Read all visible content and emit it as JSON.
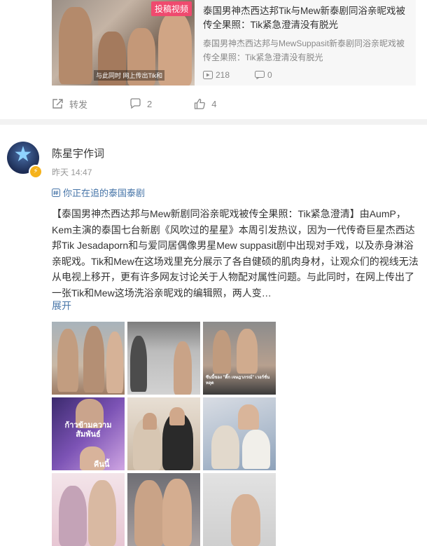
{
  "repost": {
    "tag": "投稿视频",
    "thumb_caption": "与此同时 网上传出Tik和",
    "title": "泰国男神杰西达邦Tik与Mew新泰剧同浴亲昵戏被传全果照：Tik紧急澄清没有脱光",
    "subtitle": "泰国男神杰西达邦与MewSuppasit新泰剧同浴亲昵戏被传全果照：Tik紧急澄清没有脱光",
    "views": "218",
    "comments": "0"
  },
  "actions": {
    "repost_label": "转发",
    "comment_count": "2",
    "like_count": "4"
  },
  "post": {
    "username": "陈星宇作词",
    "timestamp": "昨天 14:47",
    "topic": "你正在追的泰国泰剧",
    "text": "【泰国男神杰西达邦与Mew新剧同浴亲昵戏被传全果照：Tik紧急澄清】由AumP，Kem主演的泰国七台新剧《风吹过的星星》本周引发热议，因为一代传奇巨星杰西达邦Tik Jesadaporn和与爱同居偶像男星Mew suppasit剧中出现对手戏，以及赤身淋浴亲昵戏。Tik和Mew在这场戏里充分展示了各自健硕的肌肉身材，让观众们的视线无法从电视上移开，更有许多网友讨论关于人物配对属性问题。与此同时，在网上传出了一张Tik和Mew这场洗浴亲昵戏的编辑照，两人变…",
    "expand_label": "展开"
  },
  "photos": [
    {
      "name": "photo-1",
      "overlay": ""
    },
    {
      "name": "photo-2",
      "overlay": ""
    },
    {
      "name": "photo-3",
      "overlay": "ซีนนี้ของ \"ติ๊ก เจษฎาภรณ์\" เวอร์ชั่นหลุด"
    },
    {
      "name": "photo-4",
      "overlay": "ก้าวข้ามความสัมพันธ์"
    },
    {
      "name": "photo-5",
      "overlay": ""
    },
    {
      "name": "photo-6",
      "overlay": ""
    },
    {
      "name": "photo-7",
      "overlay": ""
    },
    {
      "name": "photo-8",
      "overlay": ""
    },
    {
      "name": "photo-9",
      "overlay": ""
    }
  ],
  "photo4_extra": "คืนนี้",
  "colors": {
    "link": "#4775a8",
    "tag": "#ef4a6e",
    "separator": "#f2f2f2",
    "badge": "#f5b21b"
  },
  "icons": [
    "play-icon",
    "comment-bubble-icon",
    "repost-icon",
    "comment-icon",
    "like-icon",
    "topic-icon",
    "verified-badge-icon"
  ]
}
